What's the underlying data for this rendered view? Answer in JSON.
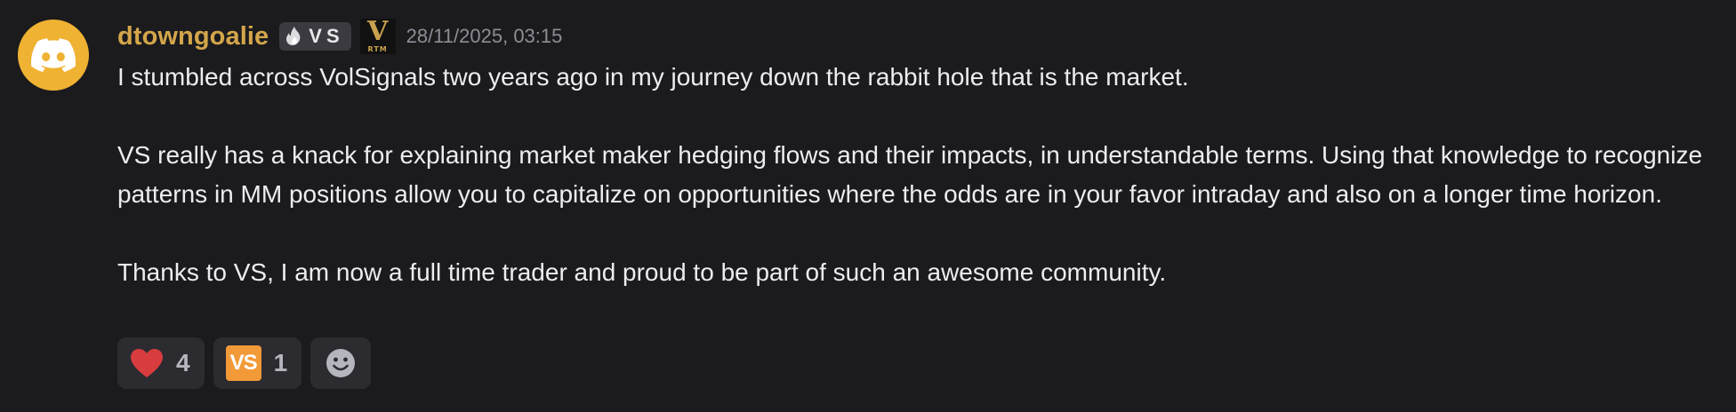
{
  "message": {
    "author": "dtowngoalie",
    "guild_tag": "VS",
    "role_icon": {
      "letter": "V",
      "caption": "RTM"
    },
    "timestamp": "28/11/2025, 03:15",
    "avatar_icon": "discord-logo-icon",
    "paragraphs": [
      "I stumbled across VolSignals two years ago in my journey down the rabbit hole that is the market.",
      "VS really has a knack for explaining market maker hedging flows and their impacts, in understandable terms. Using that knowledge to recognize patterns in MM positions allow you to capitalize on opportunities where the odds are in your favor intraday and also on a longer time horizon.",
      "Thanks to VS, I am now a full time trader and proud to be part of such an awesome community."
    ]
  },
  "reactions": [
    {
      "icon": "heart-icon",
      "count": "4"
    },
    {
      "icon": "vs-emoji-icon",
      "label": "VS",
      "count": "1"
    }
  ],
  "add_reaction_icon": "smiley-add-reaction-icon",
  "colors": {
    "background": "#1b1b1e",
    "username": "#d4a64a",
    "avatar": "#f0b232",
    "heart": "#d83c3e",
    "vs_emoji": "#f29a38"
  }
}
